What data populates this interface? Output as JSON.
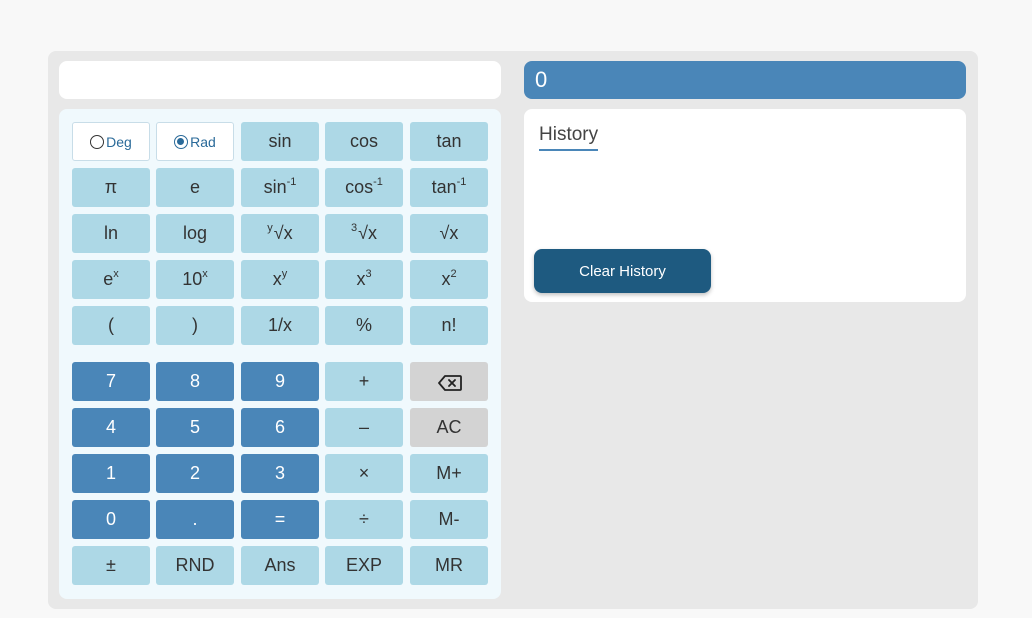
{
  "expression": {
    "value": "",
    "placeholder": ""
  },
  "result": "0",
  "history": {
    "title": "History",
    "clear_label": "Clear History"
  },
  "mode": {
    "deg_label": "Deg",
    "rad_label": "Rad",
    "selected": "Rad"
  },
  "keys": {
    "sin": "sin",
    "cos": "cos",
    "tan": "tan",
    "pi": "π",
    "e": "e",
    "asin_base": "sin",
    "asin_sup": "-1",
    "acos_base": "cos",
    "acos_sup": "-1",
    "atan_base": "tan",
    "atan_sup": "-1",
    "ln": "ln",
    "log": "log",
    "yroot_pre": "y",
    "yroot_base": "√x",
    "cbrt_pre": "3",
    "cbrt_base": "√x",
    "sqrt": "√x",
    "exp_base": "e",
    "exp_sup": "x",
    "pow10_base": "10",
    "pow10_sup": "x",
    "xy_base": "x",
    "xy_sup": "y",
    "cube_base": "x",
    "cube_sup": "3",
    "square_base": "x",
    "square_sup": "2",
    "lparen": "(",
    "rparen": ")",
    "reciprocal": "1/x",
    "percent": "%",
    "factorial": "n!",
    "d7": "7",
    "d8": "8",
    "d9": "9",
    "plus": "+",
    "d4": "4",
    "d5": "5",
    "d6": "6",
    "minus": "–",
    "ac": "AC",
    "d1": "1",
    "d2": "2",
    "d3": "3",
    "times": "×",
    "mplus": "M+",
    "d0": "0",
    "dot": ".",
    "equals": "=",
    "divide": "÷",
    "mminus": "M-",
    "negate": "±",
    "rnd": "RND",
    "ans": "Ans",
    "exp": "EXP",
    "mr": "MR"
  },
  "colors": {
    "accent": "#4a86b8",
    "key_light": "#add8e6",
    "key_gray": "#d3d3d3",
    "clear_button": "#1e5a80"
  }
}
